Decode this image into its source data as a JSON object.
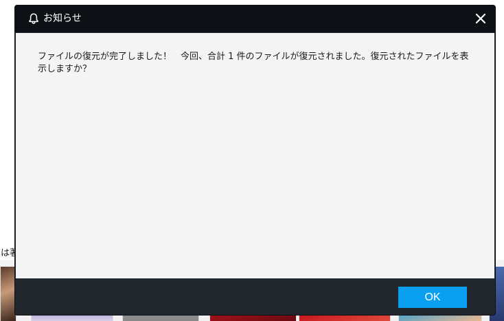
{
  "background": {
    "partial_text": "は著"
  },
  "dialog": {
    "title": "お知らせ",
    "message": "ファイルの復元が完了しました！　今回、合計 1 件のファイルが復元されました。復元されたファイルを表示しますか？",
    "ok_label": "OK",
    "icons": {
      "title_icon": "bell-icon",
      "close_icon": "close-icon"
    },
    "colors": {
      "titlebar": "#0d1014",
      "footer": "#22272e",
      "content_bg": "#f4f4f5",
      "ok_button": "#0aa0f2"
    }
  }
}
